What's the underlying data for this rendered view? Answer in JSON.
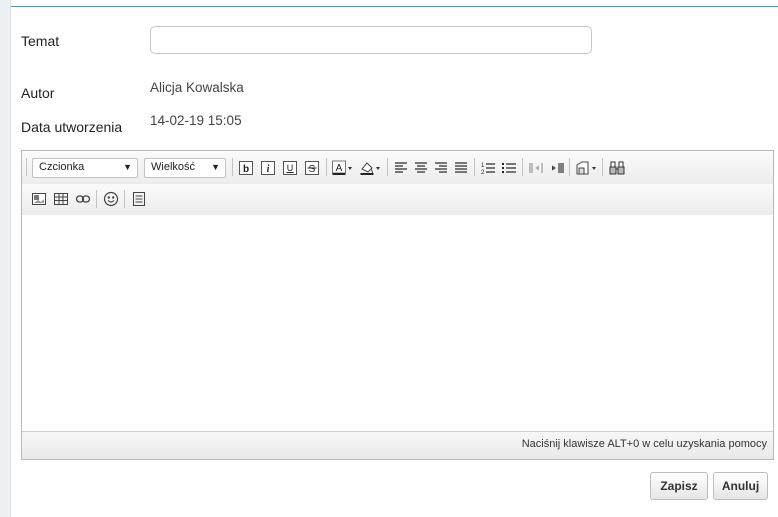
{
  "form": {
    "subject_label": "Temat",
    "subject_value": "",
    "author_label": "Autor",
    "author_value": "Alicja Kowalska",
    "created_label": "Data utworzenia",
    "created_value": "14-02-19 15:05"
  },
  "editor": {
    "font_select": "Czcionka",
    "size_select": "Wielkość",
    "toolbar_row1": [
      "bold-icon",
      "italic-icon",
      "underline-icon",
      "strikethrough-icon",
      "text-color-icon",
      "background-color-icon",
      "align-left-icon",
      "align-center-icon",
      "align-right-icon",
      "align-justify-icon",
      "numbered-list-icon",
      "bulleted-list-icon",
      "outdent-icon",
      "indent-icon",
      "styles-icon",
      "find-icon"
    ],
    "toolbar_row2": [
      "image-icon",
      "table-icon",
      "link-icon",
      "emoticon-icon",
      "source-icon"
    ],
    "status_text": "Naciśnij klawisze ALT+0 w celu uzyskania pomocy"
  },
  "actions": {
    "save_label": "Zapisz",
    "cancel_label": "Anuluj"
  },
  "colors": {
    "accent_line": "#3b9bd9",
    "toolbar_bg": "#ececec"
  }
}
